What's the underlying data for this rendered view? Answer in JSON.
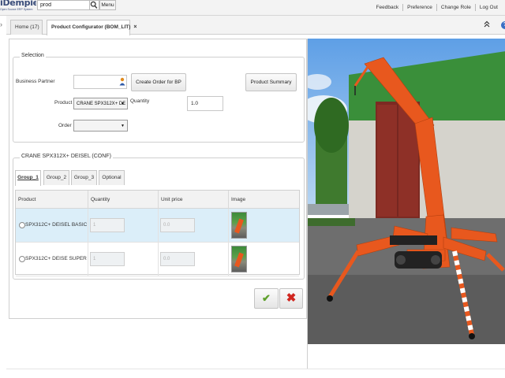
{
  "app": {
    "logo_text": "iDempiere",
    "logo_sub": "Open Source ERP System",
    "search": {
      "value": "prod",
      "placeholder": ""
    },
    "menu_label": "Menu",
    "top_links": [
      "Feedback",
      "Preference",
      "Change Role",
      "Log Out"
    ]
  },
  "tabs": [
    {
      "label": "Home (17)"
    },
    {
      "label": "Product Configurator (BOM_LIT)",
      "close": "×"
    }
  ],
  "selection": {
    "legend": "Selection",
    "business_partner_label": "Business Partner",
    "business_partner_value": "",
    "create_order_button": "Create Order for BP",
    "product_summary_button": "Product Summary",
    "product_label": "Product",
    "product_value": "CRANE SPX312X+ DE",
    "quantity_label": "Quantity",
    "quantity_value": "1.0",
    "order_label": "Order",
    "order_value": ""
  },
  "config": {
    "legend": "CRANE SPX312X+ DEISEL (CONF)",
    "groups": [
      "Group_1",
      "Group_2",
      "Group_3",
      "Optional"
    ],
    "active_group": "Group_1",
    "columns": [
      "Product",
      "Quantity",
      "Unit price",
      "Image"
    ],
    "rows": [
      {
        "product": "SPX312C+ DEISEL BASIC",
        "quantity": "1",
        "unit_price": "0.0",
        "selected": true
      },
      {
        "product": "SPX312C+ DEISE SUPER",
        "quantity": "1",
        "unit_price": "0.0",
        "selected": false
      }
    ]
  },
  "actions": {
    "ok_icon": "check-icon",
    "cancel_icon": "x-icon"
  },
  "colors": {
    "brand": "#3a4d7a",
    "ok": "#5fa12c",
    "cancel": "#d0261f",
    "row_selected": "#dbeef9",
    "crane": "#e8581e"
  }
}
